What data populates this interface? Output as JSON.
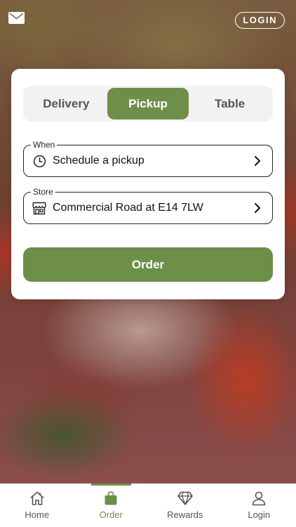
{
  "header": {
    "mail_icon": "mail-icon",
    "login_label": "LOGIN"
  },
  "mode_tabs": [
    {
      "label": "Delivery",
      "active": false
    },
    {
      "label": "Pickup",
      "active": true
    },
    {
      "label": "Table",
      "active": false
    }
  ],
  "when_field": {
    "label": "When",
    "value": "Schedule a pickup",
    "icon": "clock-icon"
  },
  "store_field": {
    "label": "Store",
    "value": "Commercial Road at E14 7LW",
    "icon": "store-icon"
  },
  "order_button": {
    "label": "Order"
  },
  "bottom_nav": [
    {
      "label": "Home",
      "icon": "home-icon",
      "active": false
    },
    {
      "label": "Order",
      "icon": "bag-icon",
      "active": true
    },
    {
      "label": "Rewards",
      "icon": "diamond-icon",
      "active": false
    },
    {
      "label": "Login",
      "icon": "user-icon",
      "active": false
    }
  ],
  "colors": {
    "accent": "#6d8f4a",
    "segment_bg": "#f2f2f2"
  }
}
